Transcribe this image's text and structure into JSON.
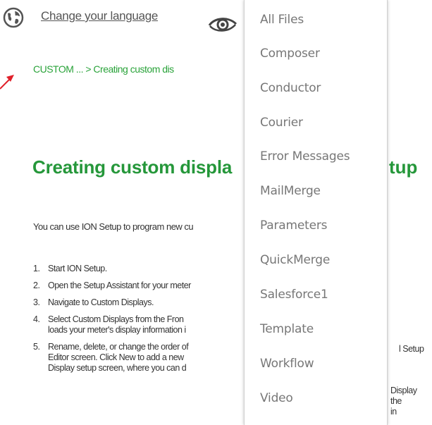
{
  "header": {
    "language_link": "Change your language"
  },
  "breadcrumb": "CUSTOM ... > Creating custom dis",
  "title": "Creating custom displa",
  "title_tail": "tup",
  "intro": "You can use ION Setup to program new cu",
  "steps": [
    {
      "num": "1.",
      "line1": "Start ION Setup.",
      "line2": ""
    },
    {
      "num": "2.",
      "line1": "Open the Setup Assistant for your meter",
      "line2": ""
    },
    {
      "num": "3.",
      "line1": "Navigate to Custom Displays.",
      "line2": ""
    },
    {
      "num": "4.",
      "line1": "Select Custom Displays from the Fron",
      "line2": "loads your meter's display information i"
    },
    {
      "num": "5.",
      "line1": "Rename, delete, or change the order of",
      "line2": "Editor screen. Click New to add a new"
    }
  ],
  "step5_line3": "Display setup screen, where you can d",
  "right_fragments": {
    "step4_a": "l Setup",
    "step5_a": "Display",
    "step5_b": "the",
    "step5_c": "in"
  },
  "dropdown": {
    "items": [
      "All Files",
      "Composer",
      "Conductor",
      "Courier",
      "Error Messages",
      "MailMerge",
      "Parameters",
      "QuickMerge",
      "Salesforce1",
      "Template",
      "Workflow",
      "Video"
    ]
  },
  "colors": {
    "accent_green": "#25973a",
    "breadcrumb_green": "#2aa33a",
    "menu_text": "#777777",
    "arrow_red": "#e0202a"
  }
}
